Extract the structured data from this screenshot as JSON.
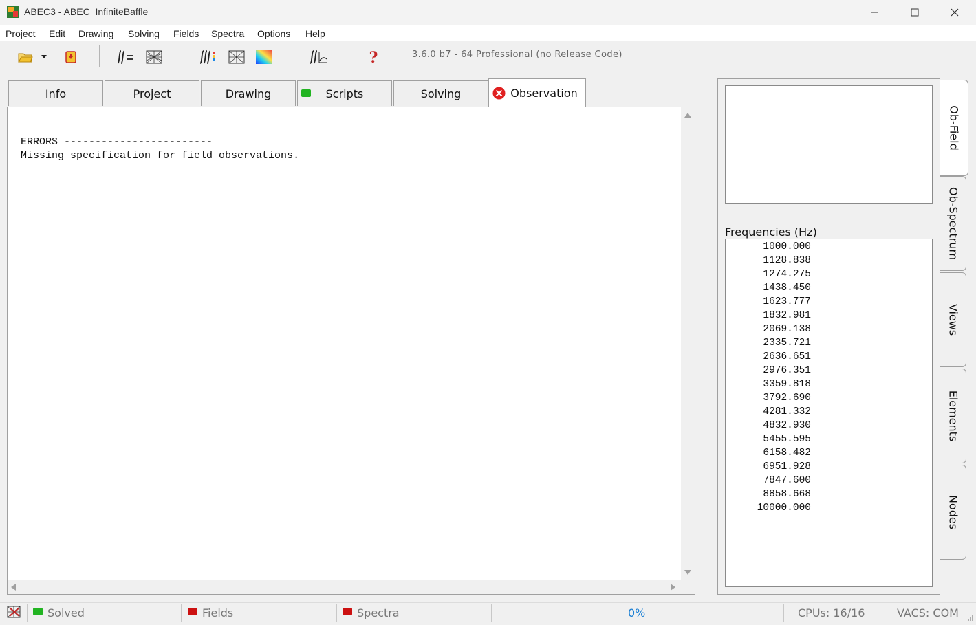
{
  "window": {
    "title": "ABEC3 - ABEC_InfiniteBaffle",
    "controls": [
      "minimize-icon",
      "maximize-icon",
      "close-icon"
    ]
  },
  "menu": [
    "Project",
    "Edit",
    "Drawing",
    "Solving",
    "Fields",
    "Spectra",
    "Options",
    "Help"
  ],
  "toolbar": {
    "icons": [
      "open-folder-icon",
      "dropdown-arrow-icon",
      "save-icon",
      "solve-equations-icon",
      "mesh-icon",
      "field-solve-icon",
      "mesh-view-icon",
      "color-map-icon",
      "spectrum-icon",
      "help-icon"
    ],
    "version": "3.6.0 b7 - 64 Professional (no Release Code)"
  },
  "tabs": [
    {
      "label": "Info",
      "status": ""
    },
    {
      "label": "Project",
      "status": ""
    },
    {
      "label": "Drawing",
      "status": ""
    },
    {
      "label": "Scripts",
      "status": "ok",
      "status_color": "#22b422"
    },
    {
      "label": "Solving",
      "status": ""
    },
    {
      "label": "Observation",
      "status": "error",
      "status_color": "#e02020",
      "active": true
    }
  ],
  "log": {
    "line1": "ERRORS ------------------------",
    "line2": "Missing specification for field observations."
  },
  "right_panel": {
    "freq_label": "Frequencies  (Hz)",
    "frequencies": [
      "1000.000",
      "1128.838",
      "1274.275",
      "1438.450",
      "1623.777",
      "1832.981",
      "2069.138",
      "2335.721",
      "2636.651",
      "2976.351",
      "3359.818",
      "3792.690",
      "4281.332",
      "4832.930",
      "5455.595",
      "6158.482",
      "6951.928",
      "7847.600",
      "8858.668",
      "10000.000"
    ],
    "side_tabs": [
      "Ob-Field",
      "Ob-Spectrum",
      "Views",
      "Elements",
      "Nodes"
    ]
  },
  "status": {
    "solved": "Solved",
    "fields": "Fields",
    "spectra": "Spectra",
    "progress": "0%",
    "cpus": "CPUs: 16/16",
    "vacs": "VACS: COM",
    "green": "#22b422",
    "red": "#cc1111",
    "progress_color": "#1a7fd4"
  }
}
